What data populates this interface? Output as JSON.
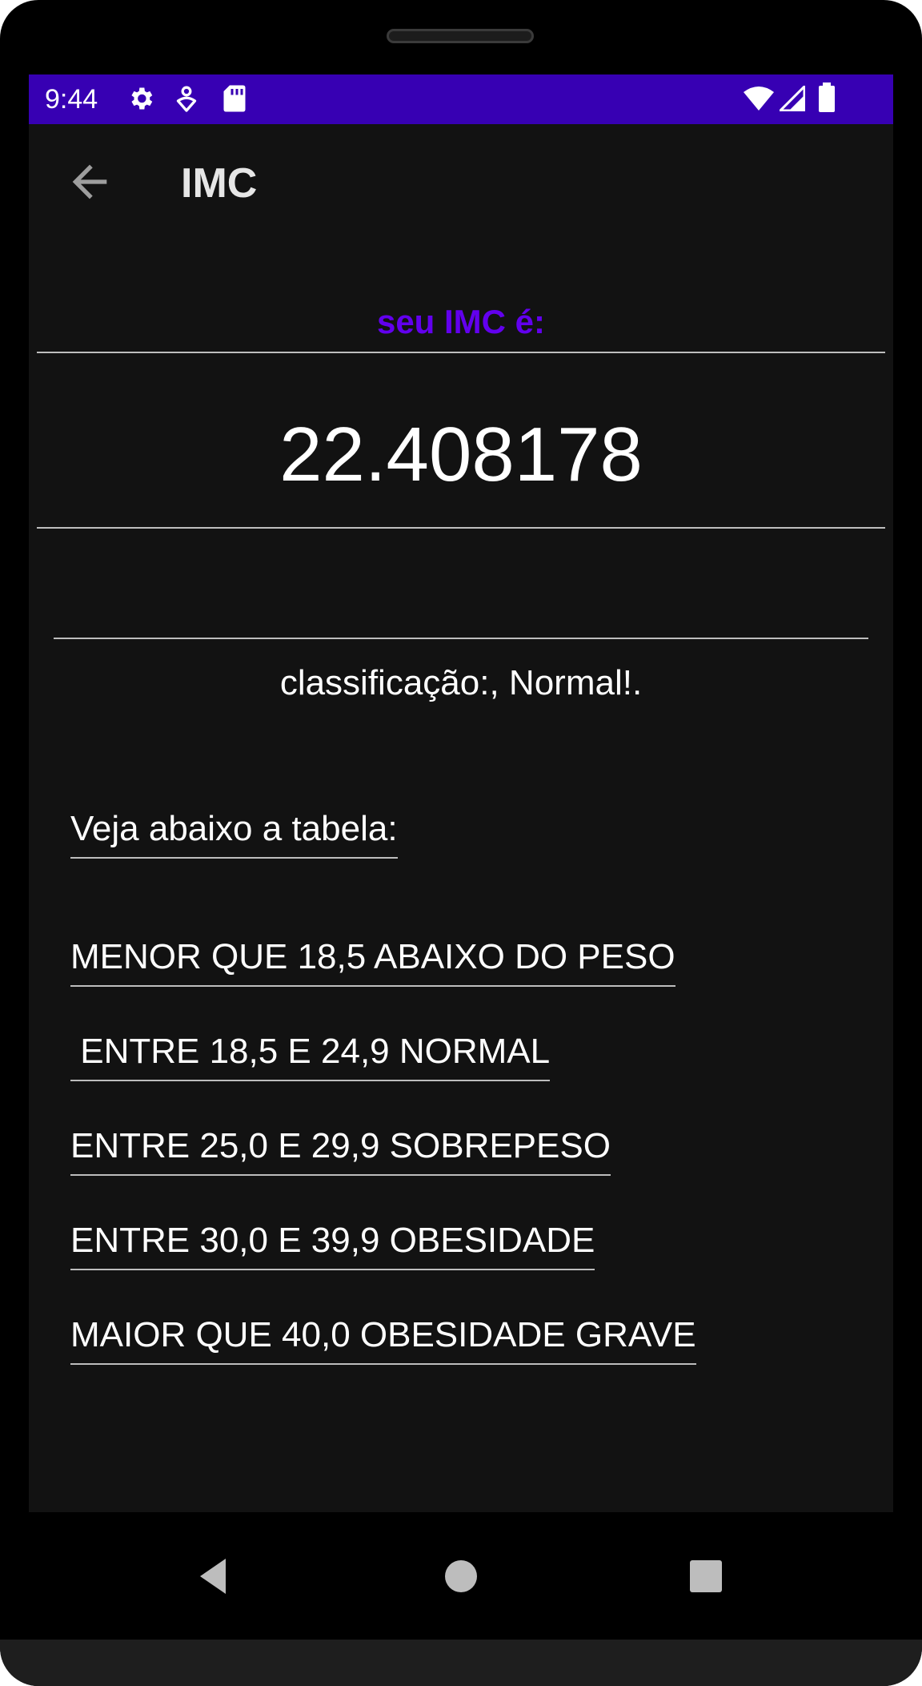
{
  "status_bar": {
    "time": "9:44",
    "icons_left": [
      "settings-gear-icon",
      "location-pin-icon",
      "sd-card-icon"
    ],
    "icons_right": [
      "wifi-icon",
      "cell-signal-icon",
      "battery-icon"
    ],
    "background": "#3700b3"
  },
  "app_bar": {
    "title": "IMC",
    "back_icon": "arrow-back-icon"
  },
  "result": {
    "heading": "seu IMC é:",
    "value": "22.408178",
    "classification": "classificação:, Normal!."
  },
  "table": {
    "title": "Veja abaixo a tabela:",
    "items": [
      "MENOR QUE 18,5 ABAIXO DO PESO",
      " ENTRE 18,5 E 24,9 NORMAL",
      "ENTRE 25,0 E 29,9 SOBREPESO",
      "ENTRE 30,0 E 39,9 OBESIDADE",
      "MAIOR QUE 40,0 OBESIDADE GRAVE"
    ]
  },
  "nav_bar": {
    "buttons": [
      "back-triangle-icon",
      "home-circle-icon",
      "recents-square-icon"
    ]
  },
  "colors": {
    "accent": "#6200ee",
    "screen_background": "#121212",
    "status_bar": "#3700b3",
    "divider": "#bdbdbd"
  }
}
